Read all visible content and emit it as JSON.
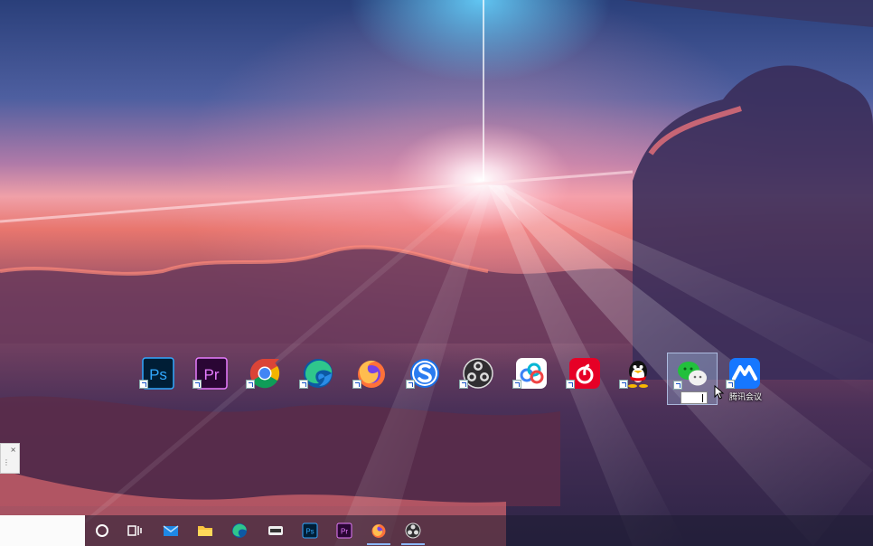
{
  "desktop": {
    "icons": [
      {
        "name": "photoshop",
        "label": "",
        "glyph_text": "Ps",
        "color": "#31a8ff"
      },
      {
        "name": "premiere",
        "label": "",
        "glyph_text": "Pr",
        "color": "#e77cff"
      },
      {
        "name": "chrome",
        "label": "",
        "glyph_text": ""
      },
      {
        "name": "edge",
        "label": "",
        "glyph_text": ""
      },
      {
        "name": "firefox",
        "label": "",
        "glyph_text": ""
      },
      {
        "name": "sogou",
        "label": "",
        "glyph_text": ""
      },
      {
        "name": "obs",
        "label": "",
        "glyph_text": ""
      },
      {
        "name": "baidu-netdisk",
        "label": "",
        "glyph_text": ""
      },
      {
        "name": "netease-music",
        "label": "",
        "glyph_text": ""
      },
      {
        "name": "qq",
        "label": "",
        "glyph_text": ""
      },
      {
        "name": "wechat",
        "label": "",
        "glyph_text": "",
        "selected": true,
        "renaming": true
      },
      {
        "name": "tencent-meeting",
        "label": "腾讯会议",
        "glyph_text": ""
      }
    ]
  },
  "side_panel": {
    "close_glyph": "×",
    "more_glyph": "⋮"
  },
  "taskbar": {
    "items": [
      {
        "name": "cortana",
        "icon": "circle-icon"
      },
      {
        "name": "task-view",
        "icon": "task-view-icon"
      },
      {
        "name": "mail",
        "icon": "mail-icon"
      },
      {
        "name": "file-explorer",
        "icon": "folder-icon"
      },
      {
        "name": "edge",
        "icon": "edge-icon"
      },
      {
        "name": "media",
        "icon": "media-icon"
      },
      {
        "name": "photoshop",
        "icon": "ps-icon",
        "text": "Ps"
      },
      {
        "name": "premiere",
        "icon": "pr-icon",
        "text": "Pr"
      },
      {
        "name": "firefox",
        "icon": "firefox-icon",
        "active": true
      },
      {
        "name": "obs",
        "icon": "obs-icon",
        "active": true
      }
    ]
  }
}
